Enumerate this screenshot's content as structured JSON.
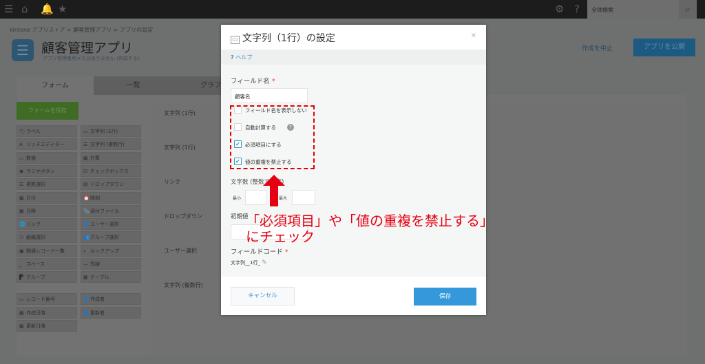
{
  "topbar": {
    "search_placeholder": "全体検索",
    "icons": [
      "menu-icon",
      "home-icon",
      "bell-icon",
      "star-icon",
      "gear-icon",
      "help-icon",
      "search-icon"
    ]
  },
  "breadcrumb": [
    "kintone アプリストア",
    ">",
    "顧客管理アプリ",
    ">",
    "アプリの設定"
  ],
  "app": {
    "title": "顧客管理アプリ",
    "memo": "アプリ管理者用メモはありません",
    "memo_link": "(作成する)",
    "cancel_label": "作成を中止",
    "publish_label": "アプリを公開"
  },
  "tabs": [
    "フォーム",
    "一覧",
    "グラフ"
  ],
  "form_save_label": "フォームを保存",
  "palette": [
    {
      "label": "ラベル",
      "icon": "🏷"
    },
    {
      "label": "文字列 (1行)",
      "icon": "▭"
    },
    {
      "label": "リッチエディター",
      "icon": "A"
    },
    {
      "label": "文字列 (複数行)",
      "icon": "☰"
    },
    {
      "label": "数値",
      "icon": "▭"
    },
    {
      "label": "計算",
      "icon": "▦"
    },
    {
      "label": "ラジオボタン",
      "icon": "◉"
    },
    {
      "label": "チェックボックス",
      "icon": "☑"
    },
    {
      "label": "複数選択",
      "icon": "☰"
    },
    {
      "label": "ドロップダウン",
      "icon": "▤"
    },
    {
      "label": "日付",
      "icon": "▦"
    },
    {
      "label": "時刻",
      "icon": "⏰"
    },
    {
      "label": "日時",
      "icon": "▦"
    },
    {
      "label": "添付ファイル",
      "icon": "📎"
    },
    {
      "label": "リンク",
      "icon": "🌐"
    },
    {
      "label": "ユーザー選択",
      "icon": "👤"
    },
    {
      "label": "組織選択",
      "icon": "⚇"
    },
    {
      "label": "グループ選択",
      "icon": "👥"
    },
    {
      "label": "関連レコード一覧",
      "icon": "▣"
    },
    {
      "label": "ルックアップ",
      "icon": "⌕"
    },
    {
      "label": "スペース",
      "icon": "⎵"
    },
    {
      "label": "罫線",
      "icon": "—"
    },
    {
      "label": "グループ",
      "icon": "▛"
    },
    {
      "label": "テーブル",
      "icon": "▦"
    }
  ],
  "system_fields": [
    {
      "label": "レコード番号",
      "icon": "▭"
    },
    {
      "label": "作成者",
      "icon": "👤"
    },
    {
      "label": "作成日時",
      "icon": "▦"
    },
    {
      "label": "更新者",
      "icon": "👤"
    },
    {
      "label": "更新日時",
      "icon": "▦"
    }
  ],
  "canvas_fields": [
    "文字列 (1行)",
    "文字列 (1行)",
    "リンク",
    "ドロップダウン",
    "ユーザー選択",
    "文字列 (複数行)"
  ],
  "modal": {
    "title": "文字列（1行）の設定",
    "close": "×",
    "help": "ヘルプ",
    "field_name_label": "フィールド名",
    "required_mark": "*",
    "field_name_value": "顧客名",
    "options": [
      {
        "label": "フィールド名を表示しない",
        "checked": false
      },
      {
        "label": "自動計算する",
        "checked": false
      },
      {
        "label": "必須項目にする",
        "checked": true
      },
      {
        "label": "値の重複を禁止する",
        "checked": true
      }
    ],
    "char_count_label": "文字数 (整数で指定)",
    "min_label": "最小",
    "max_label": "最大",
    "default_label": "初期値",
    "field_code_label": "フィールドコード",
    "field_code_value": "文字列__1行_",
    "cancel_label": "キャンセル",
    "save_label": "保存"
  },
  "annotation": {
    "line1": "「必須項目」や「値の重複を禁止する」",
    "line2": "にチェック",
    "color": "#e60012"
  }
}
